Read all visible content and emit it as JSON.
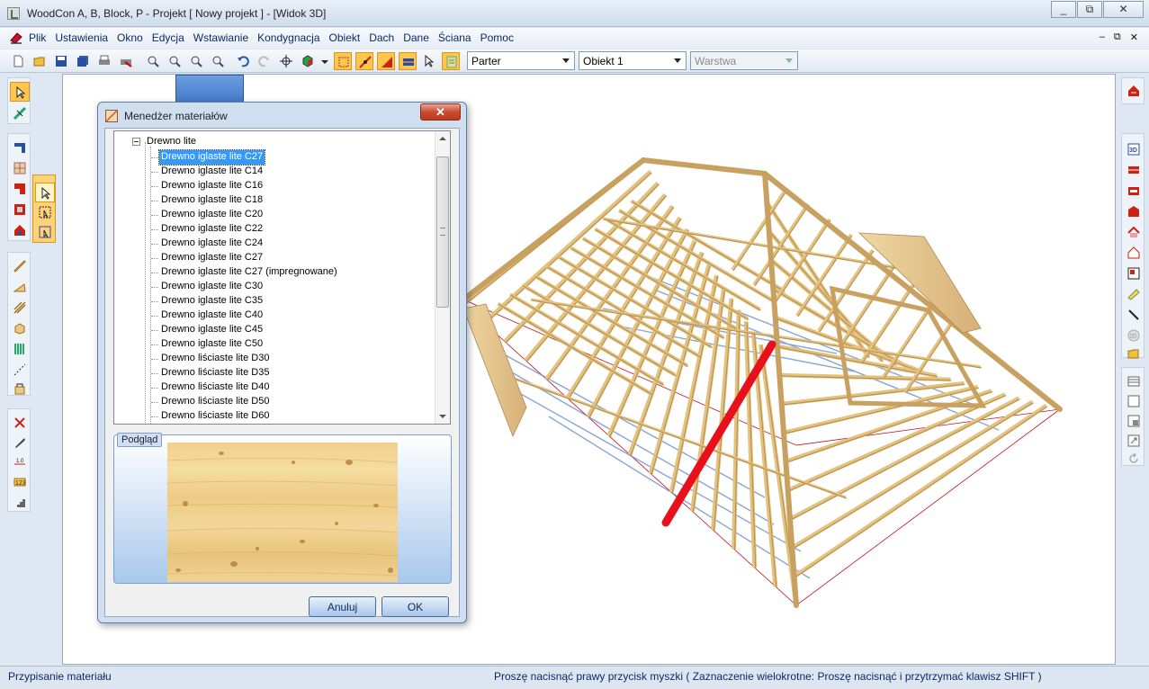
{
  "window": {
    "title": "WoodCon A, B, Block, P - Projekt [ Nowy projekt ] - [Widok 3D]",
    "minimize": "▭",
    "restore": "⧉",
    "close": "✕"
  },
  "menu": {
    "items": [
      "Plik",
      "Ustawienia",
      "Okno",
      "Edycja",
      "Wstawianie",
      "Kondygnacja",
      "Obiekt",
      "Dach",
      "Dane",
      "Ściana",
      "Pomoc"
    ],
    "mdi_min": "–",
    "mdi_restore": "⧉",
    "mdi_close": "✕"
  },
  "toolbar": {
    "floor_combo": "Parter",
    "object_combo": "Obiekt 1",
    "layer_combo": "Warstwa"
  },
  "dialog": {
    "title": "Menedżer materiałów",
    "close": "✕",
    "tree_root": "Drewno lite",
    "items": [
      "Drewno iglaste lite C27",
      "Drewno iglaste lite C14",
      "Drewno iglaste lite C16",
      "Drewno iglaste lite C18",
      "Drewno iglaste lite C20",
      "Drewno iglaste lite C22",
      "Drewno iglaste lite C24",
      "Drewno iglaste lite C27",
      "Drewno iglaste lite C27 (impregnowane)",
      "Drewno iglaste lite C30",
      "Drewno iglaste lite C35",
      "Drewno iglaste lite C40",
      "Drewno iglaste lite C45",
      "Drewno iglaste lite C50",
      "Drewno liściaste lite D30",
      "Drewno liściaste lite D35",
      "Drewno liściaste lite D40",
      "Drewno liściaste lite D50",
      "Drewno liściaste lite D60"
    ],
    "selected_index": 0,
    "preview_label": "Podgląd",
    "cancel": "Anuluj",
    "ok": "OK"
  },
  "status": {
    "left": "Przypisanie materiału",
    "right": "Proszę nacisnąć prawy przycisk myszki ( Zaznaczenie wielokrotne: Proszę nacisnąć i przytrzymać klawisz SHIFT )"
  },
  "colors": {
    "accent_orange": "#ffc64d",
    "timber": "#e9c98a",
    "highlight_rafter": "#e8101a"
  }
}
